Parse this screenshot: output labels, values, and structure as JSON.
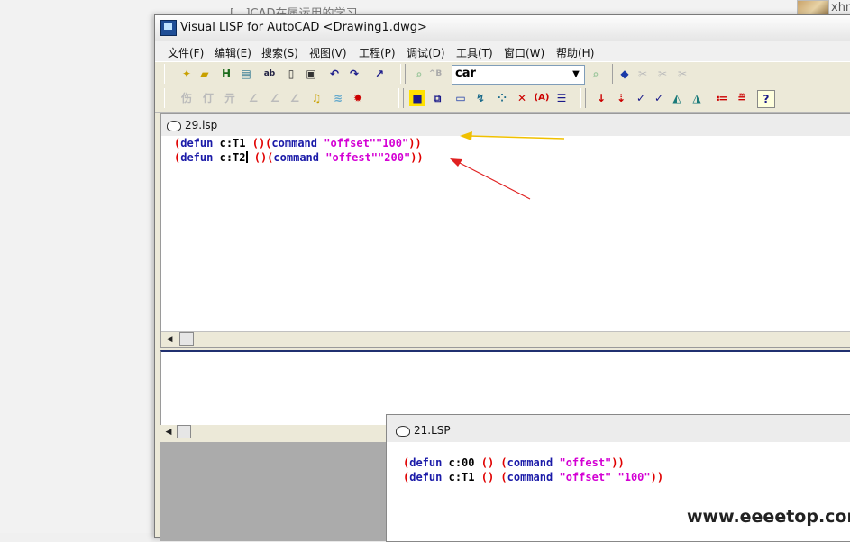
{
  "background": {
    "page_title": "[...]CAD在属运用的学习",
    "user_name": "xhn"
  },
  "window": {
    "title": "Visual LISP for AutoCAD <Drawing1.dwg>",
    "menu": [
      "文件(F)",
      "编辑(E)",
      "搜索(S)",
      "视图(V)",
      "工程(P)",
      "调试(D)",
      "工具(T)",
      "窗口(W)",
      "帮助(H)"
    ],
    "toolbar": {
      "combo_value": "car",
      "buttons_row1": [
        "new-file-icon",
        "open-file-icon",
        "save-icon",
        "print-icon",
        "cut-icon",
        "copy-icon",
        "paste-icon",
        "undo-icon",
        "redo-icon",
        "complete-word-icon",
        "find-icon",
        "find-replace-icon",
        "load-icon",
        "toggle-breakpoint-icon",
        "apropos-icon",
        "inspect-icon"
      ],
      "buttons_row2": [
        "format-icon",
        "comment-icon",
        "uncomment-icon",
        "load-selection-icon",
        "check-icon",
        "watch-icon",
        "step-icon",
        "activate-autocad-icon",
        "reset-icon",
        "continue-icon",
        "quit-icon",
        "step-into-icon",
        "step-over-icon",
        "step-out-icon",
        "last-break-icon",
        "help-icon"
      ]
    }
  },
  "editor1": {
    "tab": "29.lsp",
    "lines": [
      {
        "name": "c:T1",
        "value": "100"
      },
      {
        "name": "c:T2",
        "value": "200"
      }
    ],
    "keyword_defun": "defun",
    "keyword_command": "command",
    "string_offset": "\"offset\"",
    "string_offest": "\"offest\""
  },
  "editor2": {
    "tab": "21.LSP",
    "line1": {
      "name": "c:00",
      "cmd": "\"offest\""
    },
    "line2": {
      "name": "c:T1",
      "cmd": "\"offset\"",
      "value": "\"100\""
    }
  },
  "watermark": "www.eeeetop.com",
  "colors": {
    "paren": "#e00000",
    "keyword": "#1a1aa8",
    "string": "#d400d4",
    "arrow_yellow": "#f0c000",
    "arrow_red": "#e02020"
  }
}
